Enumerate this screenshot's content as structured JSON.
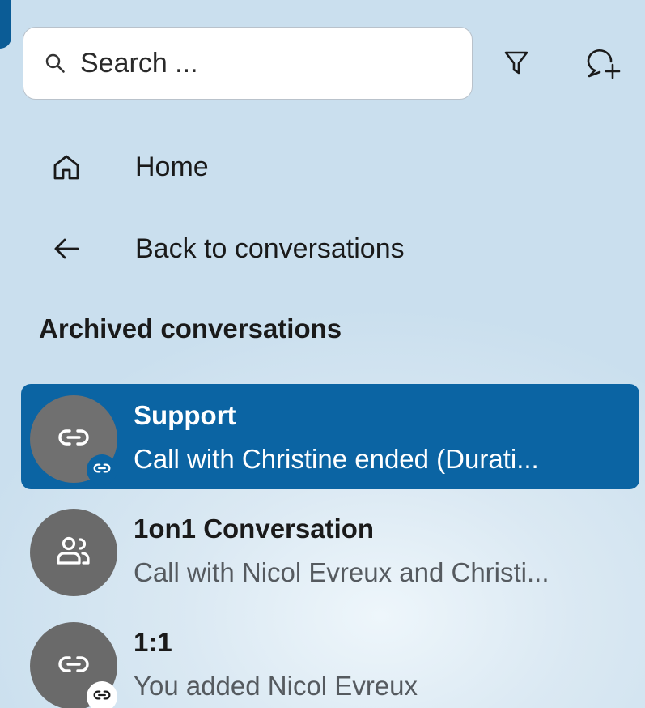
{
  "search": {
    "placeholder": "Search ...",
    "icon": "search-icon"
  },
  "toolbar": {
    "filter_icon": "filter-icon",
    "new_conversation_icon": "new-chat-icon"
  },
  "nav": {
    "home_label": "Home",
    "back_label": "Back to conversations"
  },
  "section": {
    "title": "Archived conversations"
  },
  "conversations": [
    {
      "title": "Support",
      "subtitle": "Call with Christine ended (Durati...",
      "avatar_icon": "link-icon",
      "badge_icon": "link-icon",
      "selected": true
    },
    {
      "title": "1on1 Conversation",
      "subtitle": "Call with Nicol Evreux and Christi...",
      "avatar_icon": "people-icon",
      "selected": false
    },
    {
      "title": "1:1",
      "subtitle": "You added Nicol Evreux",
      "avatar_icon": "link-icon",
      "badge_icon": "link-icon",
      "selected": false
    }
  ],
  "colors": {
    "accent": "#0b64a3",
    "avatar": "#6a6a6a",
    "background": "#d3e4ef"
  }
}
